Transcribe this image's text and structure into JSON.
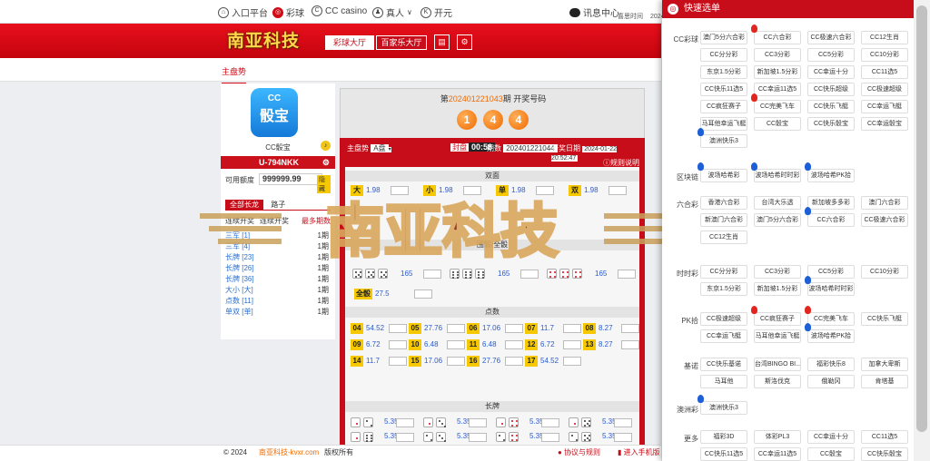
{
  "topnav": {
    "items": [
      "入口平台",
      "彩球",
      "CC casino",
      "真人",
      "开元"
    ],
    "right_label": "讯息中心",
    "time_prefix": "喜思时间",
    "time_year": "2024"
  },
  "header": {
    "logo": "南亚科技",
    "hall_a": "彩球大厅",
    "hall_b": "百家乐大厅",
    "sub_tab": "主盘势"
  },
  "left": {
    "brand": "CC骰宝",
    "username": "U-794NKK",
    "limit_label": "可用额度",
    "limit_value": "999999.99",
    "hide_btn": "隐藏",
    "tab_all": "全部长龙",
    "tab_b": "路子",
    "th1": "连续开奖",
    "th2": "连续开奖",
    "th3": "最多期数",
    "rows": [
      {
        "label": "三军 [1]",
        "v": "1期"
      },
      {
        "label": "三军 [4]",
        "v": "1期"
      },
      {
        "label": "长牌 [23]",
        "v": "1期"
      },
      {
        "label": "长牌 [26]",
        "v": "1期"
      },
      {
        "label": "长牌 [36]",
        "v": "1期"
      },
      {
        "label": "大小 [大]",
        "v": "1期"
      },
      {
        "label": "点数 [11]",
        "v": "1期"
      },
      {
        "label": "单双 [单]",
        "v": "1期"
      }
    ]
  },
  "draw": {
    "title_pre": "第",
    "period": "202401221043",
    "title_post": "期 开奖号码",
    "balls": [
      "1",
      "4",
      "4"
    ]
  },
  "game": {
    "mode": "主盘势",
    "pan": "A盘",
    "countdown_label": "封盘",
    "countdown": "00:58",
    "period_label": "期数",
    "period": "202401221044",
    "date_label": "开奖日期",
    "date": "2024-01-22 20:52:47",
    "rules": "规则说明",
    "sec_bigsmall": "双面",
    "sec_points": "点数",
    "sec_long": "长牌",
    "sec_triple": "围骰/全骰",
    "bigsmall": [
      {
        "l": "大",
        "o": "1.98"
      },
      {
        "l": "小",
        "o": "1.98"
      },
      {
        "l": "单",
        "o": "1.98"
      },
      {
        "l": "双",
        "o": "1.98"
      }
    ],
    "triple_odds": [
      "165",
      "165",
      "165"
    ],
    "quan": "全骰",
    "quan_odds": "27.5",
    "points": [
      {
        "l": "04",
        "o": "54.52"
      },
      {
        "l": "05",
        "o": "27.76"
      },
      {
        "l": "06",
        "o": "17.06"
      },
      {
        "l": "07",
        "o": "11.7"
      },
      {
        "l": "08",
        "o": "8.27"
      },
      {
        "l": "09",
        "o": "6.72"
      },
      {
        "l": "10",
        "o": "6.48"
      },
      {
        "l": "11",
        "o": "6.48"
      },
      {
        "l": "12",
        "o": "6.72"
      },
      {
        "l": "13",
        "o": "8.27"
      },
      {
        "l": "14",
        "o": "11.7"
      },
      {
        "l": "15",
        "o": "17.06"
      },
      {
        "l": "16",
        "o": "27.76"
      },
      {
        "l": "17",
        "o": "54.52"
      }
    ],
    "long_odds": "5.35"
  },
  "footer": {
    "copy": "© 2024",
    "site": "南亚科技-kvxr.com",
    "rights": "版权所有",
    "protocol": "协议与规则",
    "mobile": "进入手机版"
  },
  "quick": {
    "title": "快速选单",
    "cats": [
      {
        "name": "CC彩球",
        "tags": [
          "澳门5分六合彩",
          "CC六合彩",
          "CC极速六合彩",
          "CC12生肖",
          "CC分分彩",
          "CC3分彩",
          "CC5分彩",
          "CC10分彩",
          "东京1.5分彩",
          "新加坡1.5分彩",
          "CC幸运十分",
          "CC11选5",
          "CC快乐11选5",
          "CC幸运11选5",
          "CC快乐超级",
          "CC极速超级",
          "CC疯狂赛子",
          "CC完美飞车",
          "CC快乐飞艇",
          "CC幸运飞艇",
          "马耳他幸运飞艇",
          "CC骰宝",
          "CC快乐骰宝",
          "CC幸运骰宝",
          "澳洲快乐3"
        ]
      },
      {
        "name": "区块链",
        "tags": [
          "波场哈希彩",
          "波场哈希时时彩",
          "波场哈希PK拾"
        ]
      },
      {
        "name": "六合彩",
        "tags": [
          "香港六合彩",
          "台湾大乐透",
          "新加坡多多彩",
          "澳门六合彩",
          "新澳门六合彩",
          "澳门5分六合彩",
          "CC六合彩",
          "CC极速六合彩",
          "CC12生肖"
        ]
      },
      {
        "name": "时时彩",
        "tags": [
          "CC分分彩",
          "CC3分彩",
          "CC5分彩",
          "CC10分彩",
          "东京1.5分彩",
          "新加坡1.5分彩",
          "波场哈希时时彩"
        ]
      },
      {
        "name": "PK拾",
        "tags": [
          "CC极速超级",
          "CC疯狂赛子",
          "CC完美飞车",
          "CC快乐飞艇",
          "CC幸运飞艇",
          "马耳他幸运飞艇",
          "波场哈希PK拾"
        ]
      },
      {
        "name": "基诺",
        "tags": [
          "CC快乐基诺",
          "台湾BINGO BI...",
          "福彩快乐8",
          "加拿大卑斯",
          "马耳他",
          "斯洛伐克",
          "俄勒冈",
          "肯塔基"
        ]
      },
      {
        "name": "澳洲彩",
        "tags": [
          "澳洲快乐3"
        ]
      },
      {
        "name": "更多",
        "tags": [
          "福彩3D",
          "体彩PL3",
          "CC幸运十分",
          "CC11选5",
          "CC快乐11选5",
          "CC幸运11选5",
          "CC骰宝",
          "CC快乐骰宝"
        ]
      }
    ]
  },
  "watermark": "南亚科技",
  "colors": {
    "brand_red": "#c80d1a",
    "gold": "#f5c800",
    "ball": "#f06a00"
  }
}
